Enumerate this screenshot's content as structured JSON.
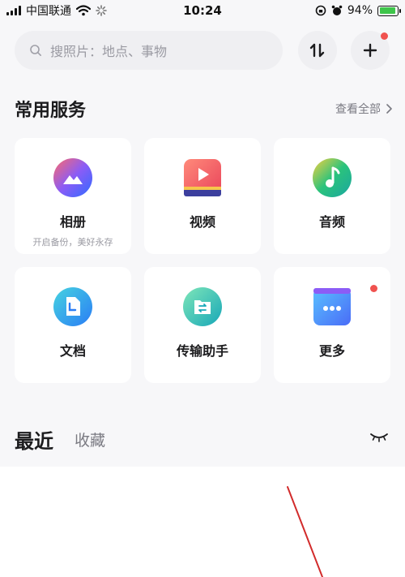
{
  "status_bar": {
    "carrier": "中国联通",
    "time": "10:24",
    "battery_percent": "94%",
    "battery_level": 0.94
  },
  "search": {
    "placeholder": "搜照片：地点、事物"
  },
  "services": {
    "title": "常用服务",
    "see_all": "查看全部",
    "items": [
      {
        "label": "相册",
        "sub": "开启备份，美好永存",
        "icon": "album-icon"
      },
      {
        "label": "视频",
        "sub": "",
        "icon": "video-icon"
      },
      {
        "label": "音频",
        "sub": "",
        "icon": "audio-icon"
      },
      {
        "label": "文档",
        "sub": "",
        "icon": "document-icon"
      },
      {
        "label": "传输助手",
        "sub": "",
        "icon": "transfer-icon"
      },
      {
        "label": "更多",
        "sub": "",
        "icon": "more-icon"
      }
    ]
  },
  "tabs": {
    "recent": "最近",
    "favorites": "收藏"
  },
  "colors": {
    "accent_red": "#f0524f",
    "battery_green": "#3ec54a"
  }
}
